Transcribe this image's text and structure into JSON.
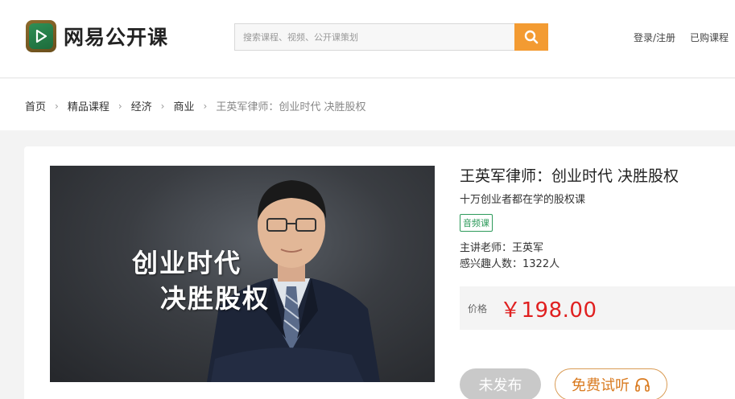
{
  "header": {
    "logo_text": "网易公开课",
    "search_placeholder": "搜索课程、视频、公开课策划",
    "login": "登录/注册",
    "purchased": "已购课程"
  },
  "breadcrumb": {
    "items": [
      "首页",
      "精品课程",
      "经济",
      "商业"
    ],
    "current": "王英军律师：创业时代 决胜股权"
  },
  "course": {
    "cover_line1": "创业时代",
    "cover_line2": "决胜股权",
    "title": "王英军律师：创业时代 决胜股权",
    "subtitle": "十万创业者都在学的股权课",
    "tag": "音频课",
    "teacher": "主讲老师：王英军",
    "interested": "感兴趣人数：1322人",
    "price_label": "价格",
    "price": "￥198.00",
    "btn_unpublished": "未发布",
    "btn_free_listen": "免费试听"
  },
  "colors": {
    "accent_orange": "#f39b32",
    "tag_green": "#2d9a5a",
    "price_red": "#e02020",
    "free_btn_orange": "#d97a1f"
  },
  "icons": {
    "logo": "play-logo-icon",
    "search": "search-icon",
    "breadcrumb_separator": "chevron-right-icon",
    "headphone": "headphone-icon"
  }
}
